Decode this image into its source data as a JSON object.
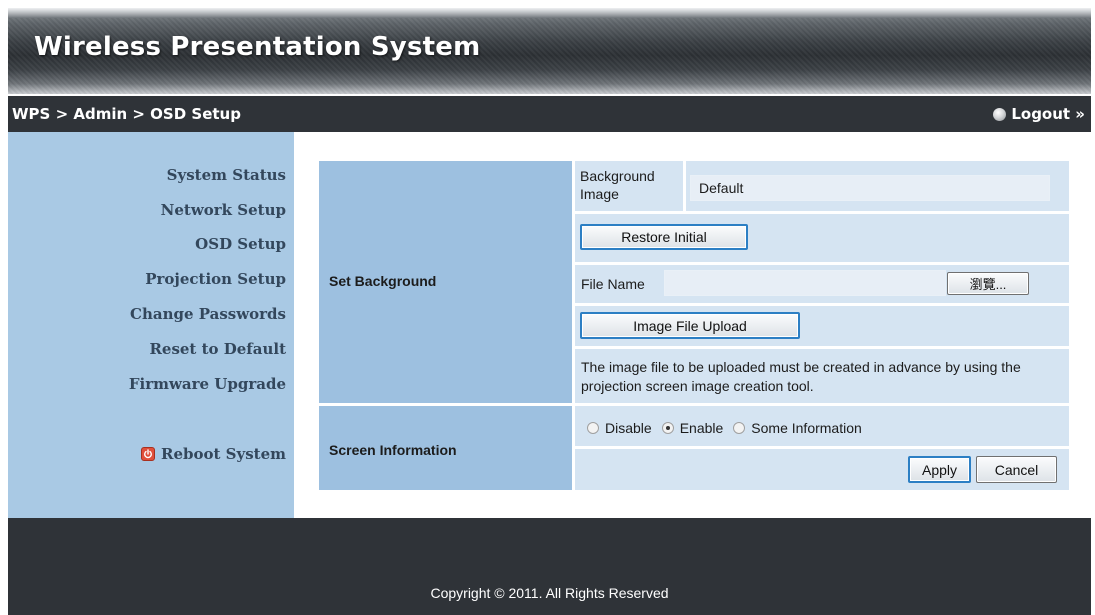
{
  "header": {
    "title": "Wireless Presentation System"
  },
  "navbar": {
    "breadcrumb": "WPS > Admin > OSD Setup",
    "logout_label": "Logout »"
  },
  "sidebar": {
    "items": [
      {
        "label": "System Status"
      },
      {
        "label": "Network Setup"
      },
      {
        "label": "OSD Setup"
      },
      {
        "label": "Projection Setup"
      },
      {
        "label": "Change Passwords"
      },
      {
        "label": "Reset to Default"
      },
      {
        "label": "Firmware Upgrade"
      }
    ],
    "reboot_label": "Reboot System"
  },
  "set_background": {
    "label": "Set Background",
    "bg_image_label": "Background Image",
    "bg_image_value": "Default",
    "restore_label": "Restore Initial",
    "file_name_label": "File Name",
    "browse_label": "瀏覽...",
    "upload_label": "Image File Upload",
    "note": "The image file to be uploaded must be created in advance by using the projection screen image creation tool."
  },
  "screen_information": {
    "label": "Screen Information",
    "options": [
      {
        "label": "Disable",
        "checked": false
      },
      {
        "label": "Enable",
        "checked": true
      },
      {
        "label": "Some Information",
        "checked": false
      }
    ],
    "apply_label": "Apply",
    "cancel_label": "Cancel"
  },
  "footer": {
    "copyright": "Copyright © 2011. All Rights Reserved"
  },
  "colors": {
    "sidebar_bg": "#a9c9e4",
    "label_cell_bg": "#9dc0e0",
    "value_cell_bg": "#d5e4f2",
    "bar_bg": "#2f3338",
    "button_border_accent": "#2c7fc4"
  }
}
